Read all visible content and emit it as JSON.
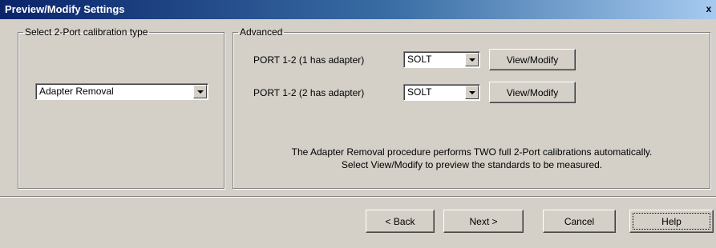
{
  "window": {
    "title": "Preview/Modify Settings",
    "close_label": "x"
  },
  "calibration_type": {
    "legend": "Select 2-Port calibration type",
    "selected": "Adapter Removal"
  },
  "advanced": {
    "legend": "Advanced",
    "rows": [
      {
        "label": "PORT 1-2 (1 has adapter)",
        "value": "SOLT",
        "button": "View/Modify"
      },
      {
        "label": "PORT 1-2 (2 has adapter)",
        "value": "SOLT",
        "button": "View/Modify"
      }
    ],
    "description_line1": "The Adapter Removal procedure performs TWO full 2-Port calibrations automatically.",
    "description_line2": "Select View/Modify to preview the standards to be measured."
  },
  "footer": {
    "back_label": "< Back",
    "next_label": "Next >",
    "cancel_label": "Cancel",
    "help_label": "Help"
  },
  "colors": {
    "dialog_background": "#d4d0c8",
    "title_gradient_start": "#0a246a",
    "title_gradient_end": "#a6caf0"
  }
}
